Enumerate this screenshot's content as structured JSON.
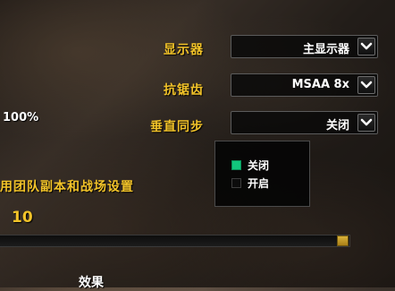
{
  "graphics": {
    "display": {
      "label": "显示器",
      "value": "主显示器"
    },
    "antialiasing": {
      "label": "抗锯齿",
      "value": "MSAA 8x"
    },
    "vsync": {
      "label": "垂直同步",
      "value": "关闭",
      "options": [
        {
          "label": "关闭",
          "selected": true
        },
        {
          "label": "开启",
          "selected": false
        }
      ]
    }
  },
  "left": {
    "percent_text": "100%",
    "raid_heading": "用团队副本和战场设置",
    "raid_level": "10",
    "raid_slider_fraction": 1.0,
    "effect_label": "效果"
  },
  "colors": {
    "label_gold": "#f2c329",
    "selected_green": "#12c77d",
    "slider_gold": "#d9b23a"
  },
  "icons": {
    "dropdown_arrow": "chevron-down-icon"
  }
}
